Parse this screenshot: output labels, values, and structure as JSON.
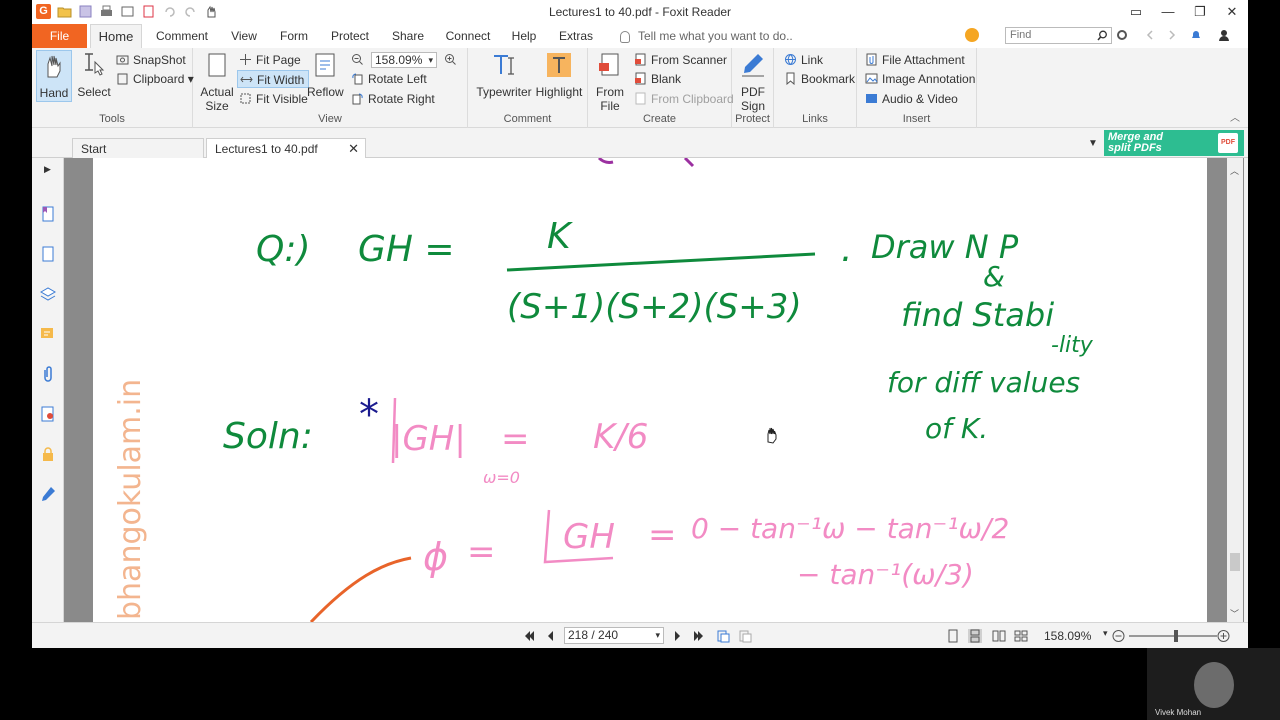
{
  "window": {
    "title": "Lectures1 to 40.pdf - Foxit Reader",
    "logo_letter": "G",
    "controls": [
      "▭",
      "—",
      "❐",
      "✕"
    ]
  },
  "ribbon_tabs": {
    "file": "File",
    "tabs": [
      "Home",
      "Comment",
      "View",
      "Form",
      "Protect",
      "Share",
      "Connect",
      "Help",
      "Extras"
    ],
    "active": "Home",
    "tell_me": "Tell me what you want to do..",
    "find_placeholder": "Find"
  },
  "ribbon": {
    "tools": {
      "group_label": "Tools",
      "hand": "Hand",
      "select": "Select",
      "snapshot": "SnapShot",
      "clipboard": "Clipboard"
    },
    "view": {
      "group_label": "View",
      "actual_size_1": "Actual",
      "actual_size_2": "Size",
      "fit_page": "Fit Page",
      "fit_width": "Fit Width",
      "fit_visible": "Fit Visible",
      "reflow": "Reflow",
      "zoom_value": "158.09%",
      "rotate_left": "Rotate Left",
      "rotate_right": "Rotate Right"
    },
    "comment": {
      "group_label": "Comment",
      "typewriter": "Typewriter",
      "highlight": "Highlight"
    },
    "create": {
      "group_label": "Create",
      "from_file_1": "From",
      "from_file_2": "File",
      "from_scanner": "From Scanner",
      "blank": "Blank",
      "from_clipboard": "From Clipboard"
    },
    "protect": {
      "group_label": "Protect",
      "pdf_sign_1": "PDF",
      "pdf_sign_2": "Sign"
    },
    "links": {
      "group_label": "Links",
      "link": "Link",
      "bookmark": "Bookmark"
    },
    "insert": {
      "group_label": "Insert",
      "file_attachment": "File Attachment",
      "image_annotation": "Image Annotation",
      "audio_video": "Audio & Video"
    }
  },
  "doc_tabs": {
    "start": "Start",
    "current": "Lectures1 to 40.pdf",
    "merge_ad_1": "Merge and",
    "merge_ad_2": "split PDFs",
    "merge_badge": "PDF"
  },
  "page_content": {
    "q_label": "Q:)",
    "gh_eq": "GH =",
    "numerator": "K",
    "denominator": "(S+1)(S+2)(S+3)",
    "dot": ".",
    "draw_np": "Draw N P",
    "amp": "&",
    "find_stabi": "find Stabi",
    "lity": "-lity",
    "for_diff": "for diff values",
    "of_k": "of K.",
    "soln": "Soln:",
    "star": "*",
    "abs_gh": "|GH|",
    "eq1": "=",
    "k_over_6": "K/6",
    "omega0": "ω=0",
    "phi": "ϕ",
    "eq2": "=",
    "angle_gh": "GH",
    "eq3": "=",
    "phase_expr": "0 − tan⁻¹ω − tan⁻¹ω/2",
    "phase_expr2": "− tan⁻¹(ω/3)",
    "watermark": "bhangokulam.in"
  },
  "status": {
    "page_indicator": "218 / 240",
    "zoom": "158.09%"
  },
  "webcam": {
    "name": "Vivek Mohan"
  },
  "colors": {
    "foxit_orange": "#f16522",
    "ink_green": "#0f8a3c",
    "ink_pink": "#f28bc4",
    "ink_navy": "#1b1b8f",
    "ink_orange": "#e8642a",
    "merge_green": "#2dbd91"
  }
}
